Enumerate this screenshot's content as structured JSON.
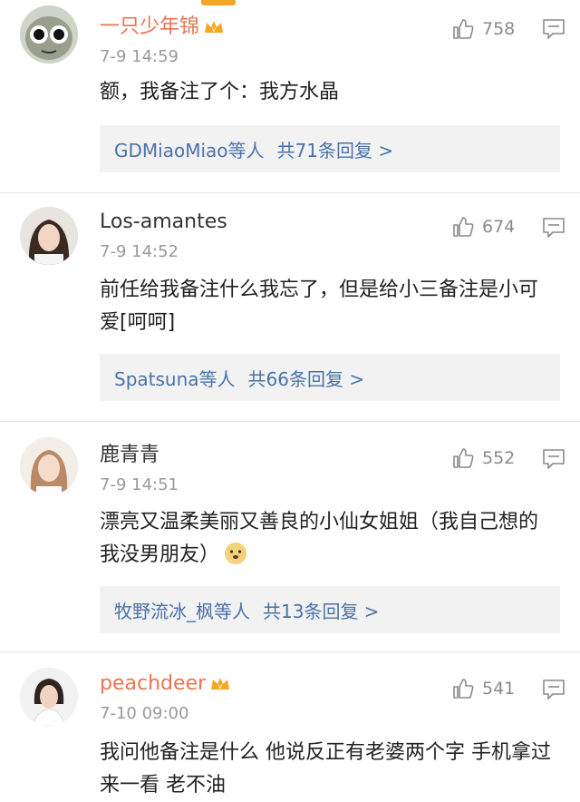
{
  "comments": [
    {
      "username": "一只少年锦",
      "timestamp": "7-9 14:59",
      "likes": "758",
      "text": "额，我备注了个：我方水晶",
      "replies": {
        "users": "GDMiaoMiao等人",
        "count": "共71条回复 >"
      }
    },
    {
      "username": "Los-amantes",
      "timestamp": "7-9 14:52",
      "likes": "674",
      "text": "前任给我备注什么我忘了，但是给小三备注是小可爱[呵呵]",
      "replies": {
        "users": "Spatsuna等人",
        "count": "共66条回复 >"
      }
    },
    {
      "username": "鹿青青",
      "timestamp": "7-9 14:51",
      "likes": "552",
      "text": "漂亮又温柔美丽又善良的小仙女姐姐（我自己想的我没男朋友）",
      "replies": {
        "users": "牧野流冰_枫等人",
        "count": "共13条回复 >"
      }
    },
    {
      "username": "peachdeer",
      "timestamp": "7-10 09:00",
      "likes": "541",
      "text": "我问他备注是什么 他说反正有老婆两个字 手机拿过来一看 老不油"
    }
  ],
  "colors": {
    "vip_username": "#eb7350",
    "reply_link": "#4a72a8",
    "reply_bg": "#f2f2f2"
  }
}
